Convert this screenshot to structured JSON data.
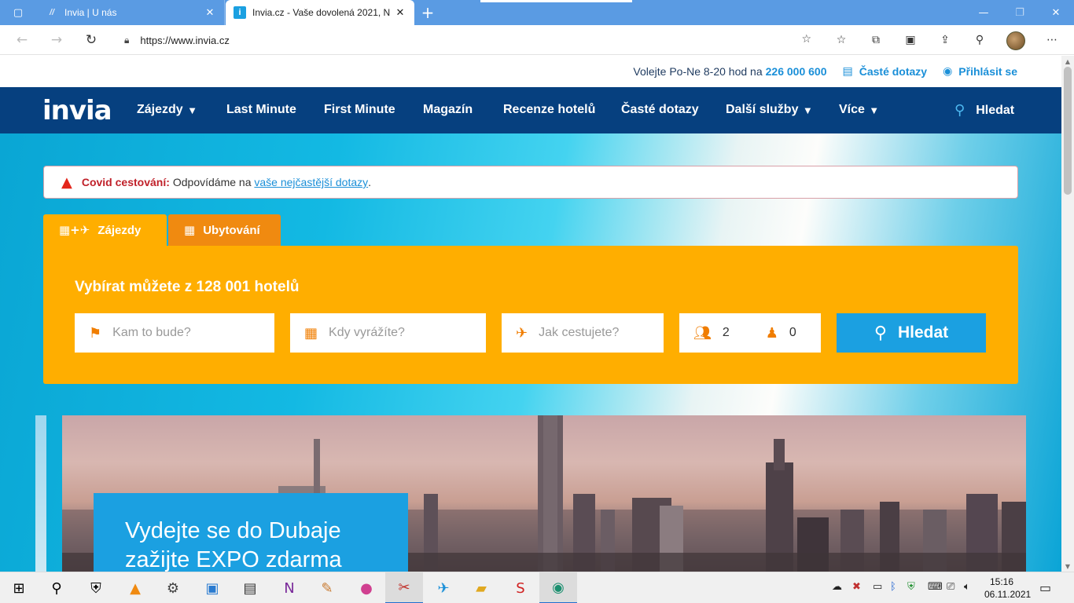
{
  "browser": {
    "tabs": [
      {
        "title": "Invia | U nás",
        "favicon": "invia-slash-icon"
      },
      {
        "title": "Invia.cz - Vaše dovolená 2021, N",
        "favicon": "invia-i-icon"
      }
    ],
    "url": "https://www.invia.cz"
  },
  "site": {
    "top_info": {
      "hours_text": "Volejte Po-Ne 8-20 hod na",
      "phone": "226 000 600",
      "faq": "Časté dotazy",
      "login": "Přihlásit se"
    },
    "logo": "invia",
    "nav": {
      "items": [
        "Zájezdy",
        "Last Minute",
        "First Minute",
        "Magazín",
        "Recenze hotelů",
        "Časté dotazy",
        "Další služby",
        "Více"
      ],
      "search": "Hledat"
    },
    "covid": {
      "title": "Covid cestování:",
      "text": "Odpovídáme na",
      "link": "vaše nejčastější dotazy",
      "end": "."
    },
    "search_tabs": [
      "Zájezdy",
      "Ubytování"
    ],
    "search": {
      "heading": "Vybírat můžete z 128 001 hotelů",
      "destination_placeholder": "Kam to bude?",
      "date_placeholder": "Kdy vyrážíte?",
      "travel_placeholder": "Jak cestujete?",
      "adults": "2",
      "children": "0",
      "button": "Hledat"
    },
    "promo": {
      "line1": "Vydejte se do Dubaje",
      "line2": "zažijte EXPO zdarma"
    }
  },
  "taskbar": {
    "time": "15:16",
    "date": "06.11.2021"
  },
  "colors": {
    "nav_bg": "#06407f",
    "accent_blue": "#1ba0e1",
    "search_orange": "#ffae00",
    "tab_orange": "#f08a10"
  }
}
